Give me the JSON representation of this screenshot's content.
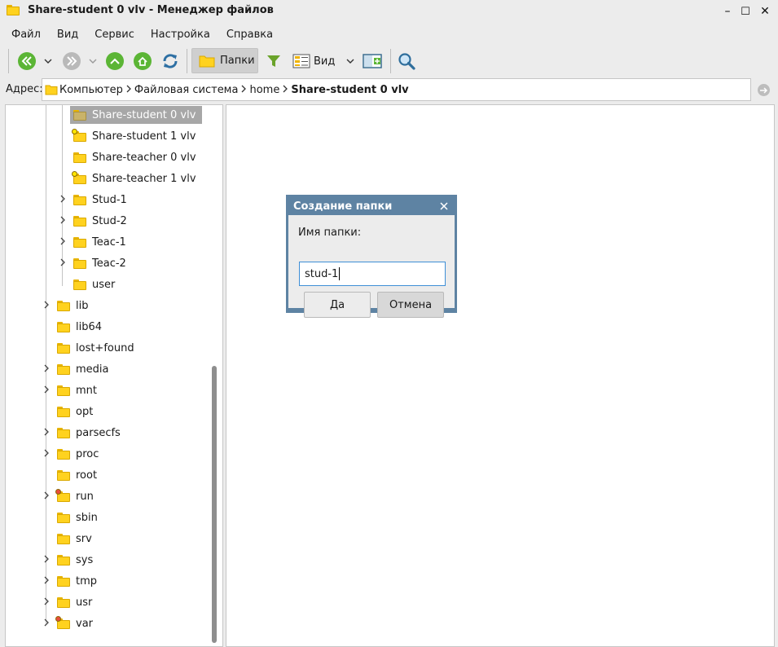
{
  "window": {
    "title": "Share-student 0 vlv - Менеджер файлов",
    "minimize": "–",
    "maximize": "☐",
    "close": "✕"
  },
  "menu": [
    "Файл",
    "Вид",
    "Сервис",
    "Настройка",
    "Справка"
  ],
  "toolbar": {
    "folders_label": "Папки",
    "view_label": "Вид",
    "back_icon": "back-arrow-icon",
    "forward_icon": "forward-arrow-icon",
    "up_icon": "up-arrow-icon",
    "home_icon": "home-icon",
    "reload_icon": "reload-icon",
    "filter_icon": "filter-icon",
    "new_window_icon": "new-window-icon",
    "search_icon": "search-icon"
  },
  "address": {
    "label": "Адрес:",
    "crumbs": [
      "Компьютер",
      "Файловая система",
      "home",
      "Share-student 0 vlv"
    ]
  },
  "tree": [
    {
      "label": "Share-student 0 vlv",
      "level": 2,
      "selected": true,
      "expandable": false,
      "badge": null
    },
    {
      "label": "Share-student 1 vlv",
      "level": 2,
      "selected": false,
      "expandable": false,
      "badge": "yellow"
    },
    {
      "label": "Share-teacher 0 vlv",
      "level": 2,
      "selected": false,
      "expandable": false,
      "badge": null
    },
    {
      "label": "Share-teacher 1 vlv",
      "level": 2,
      "selected": false,
      "expandable": false,
      "badge": "yellow"
    },
    {
      "label": "Stud-1",
      "level": 2,
      "selected": false,
      "expandable": true,
      "badge": null
    },
    {
      "label": "Stud-2",
      "level": 2,
      "selected": false,
      "expandable": true,
      "badge": null
    },
    {
      "label": "Teac-1",
      "level": 2,
      "selected": false,
      "expandable": true,
      "badge": null
    },
    {
      "label": "Teac-2",
      "level": 2,
      "selected": false,
      "expandable": true,
      "badge": null
    },
    {
      "label": "user",
      "level": 2,
      "selected": false,
      "expandable": false,
      "badge": null
    },
    {
      "label": "lib",
      "level": 1,
      "selected": false,
      "expandable": true,
      "badge": null
    },
    {
      "label": "lib64",
      "level": 1,
      "selected": false,
      "expandable": false,
      "badge": null
    },
    {
      "label": "lost+found",
      "level": 1,
      "selected": false,
      "expandable": false,
      "badge": null
    },
    {
      "label": "media",
      "level": 1,
      "selected": false,
      "expandable": true,
      "badge": null
    },
    {
      "label": "mnt",
      "level": 1,
      "selected": false,
      "expandable": true,
      "badge": null
    },
    {
      "label": "opt",
      "level": 1,
      "selected": false,
      "expandable": false,
      "badge": null
    },
    {
      "label": "parsecfs",
      "level": 1,
      "selected": false,
      "expandable": true,
      "badge": null
    },
    {
      "label": "proc",
      "level": 1,
      "selected": false,
      "expandable": true,
      "badge": null
    },
    {
      "label": "root",
      "level": 1,
      "selected": false,
      "expandable": false,
      "badge": null
    },
    {
      "label": "run",
      "level": 1,
      "selected": false,
      "expandable": true,
      "badge": "red"
    },
    {
      "label": "sbin",
      "level": 1,
      "selected": false,
      "expandable": false,
      "badge": null
    },
    {
      "label": "srv",
      "level": 1,
      "selected": false,
      "expandable": false,
      "badge": null
    },
    {
      "label": "sys",
      "level": 1,
      "selected": false,
      "expandable": true,
      "badge": null
    },
    {
      "label": "tmp",
      "level": 1,
      "selected": false,
      "expandable": true,
      "badge": null
    },
    {
      "label": "usr",
      "level": 1,
      "selected": false,
      "expandable": true,
      "badge": null
    },
    {
      "label": "var",
      "level": 1,
      "selected": false,
      "expandable": true,
      "badge": "red"
    }
  ],
  "dialog": {
    "title": "Создание папки",
    "field_label": "Имя папки:",
    "field_value": "stud-1",
    "ok_label": "Да",
    "cancel_label": "Отмена"
  },
  "colors": {
    "dialog_frame": "#5e83a3",
    "selection": "#a7a7a7",
    "folder": "#ffd21f",
    "nav_green": "#5bb535",
    "nav_green_disabled": "#b9b9b9",
    "reload": "#2d6fa3",
    "input_focus": "#3e8fd6"
  }
}
